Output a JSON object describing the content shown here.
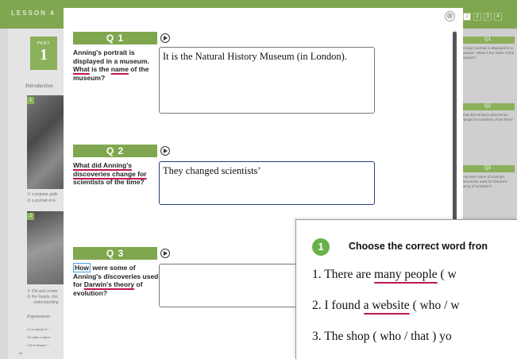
{
  "background": {
    "lesson_label": "LESSON 4",
    "part_small": "PART",
    "part_number": "1",
    "intro_label": "Introduction",
    "photo1_num": "1",
    "photo2_num": "2",
    "cap1": "① a popular galle",
    "cap2": "② a portrait of A",
    "cap3": "① Did and create",
    "cap4": "② the fossils, che",
    "cap5": "understanding",
    "expressions_label": "Expressions",
    "expr1": "L2  a variety of ~",
    "expr2": "L8  make a disco",
    "expr3": "L15  in shape / \"",
    "page_number": "62",
    "page_tabs": [
      "1",
      "2",
      "3",
      "4"
    ]
  },
  "right_panel": [
    {
      "label": "Q1",
      "text": "Anning's portrait is displayed in a museum. What is the name of the museum?"
    },
    {
      "label": "Q2",
      "text": "What did Anning's discoveries change for scientists of the time?"
    },
    {
      "label": "Q3",
      "text": "How were some of Anning's discoveries used for Darwin's theory of evolution?"
    }
  ],
  "questions": [
    {
      "label": "Q 1",
      "text_parts": [
        "Anning's portrait is displayed in a museum. ",
        "What",
        " is the ",
        "name",
        " of the museum?"
      ],
      "answer": "It is the Natural History Museum (in London)."
    },
    {
      "label": "Q 2",
      "text_parts": [
        "What did Anning's discoveries change for",
        " scientists of the time?"
      ],
      "answer": "They changed scientists’"
    },
    {
      "label": "Q 3",
      "text_parts": [
        "How",
        " were some of Anning's discoveries used for ",
        "Darwin's theory",
        " of evolution?"
      ],
      "answer": ""
    }
  ],
  "close_icon": "⊗",
  "exercise": {
    "number": "1",
    "title": "Choose the correct word fron",
    "lines": [
      {
        "prefix": "1. There are ",
        "underlined": "many people",
        "suffix": " ( w"
      },
      {
        "prefix": "2. I found ",
        "underlined": "a website",
        "suffix": " ( who / w"
      },
      {
        "prefix": "3. The shop ( who / that ) yo",
        "underlined": "",
        "suffix": ""
      }
    ]
  },
  "colors": {
    "accent": "#7fa74f",
    "underline": "#c0184c",
    "box": "#4aa3df"
  }
}
